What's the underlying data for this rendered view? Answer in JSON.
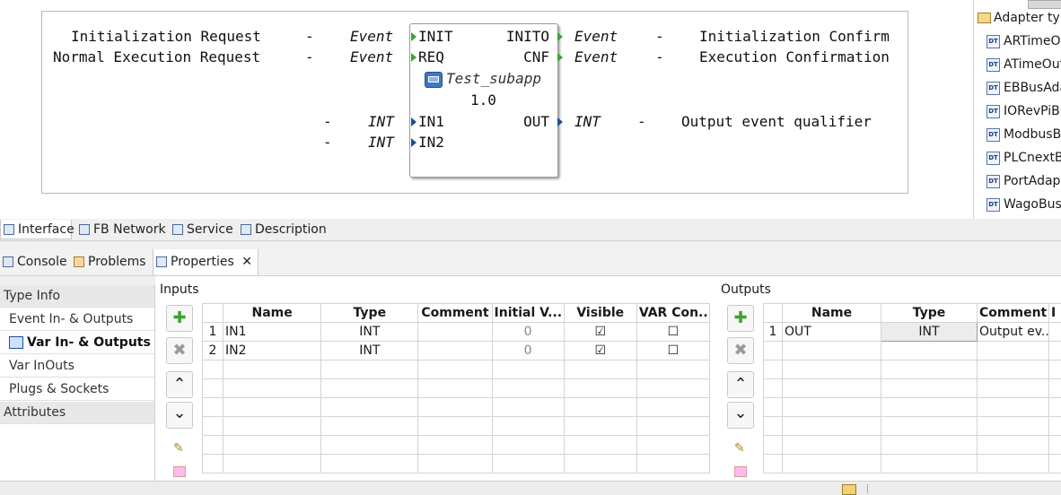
{
  "editor": {
    "left_rows": [
      {
        "desc": "Initialization Request",
        "dash": "-",
        "type": "Event"
      },
      {
        "desc": "Normal Execution Request",
        "dash": "-",
        "type": "Event"
      }
    ],
    "left_data_rows": [
      {
        "dash": "-",
        "type": "INT"
      },
      {
        "dash": "-",
        "type": "INT"
      }
    ],
    "right_rows": [
      {
        "type": "Event",
        "dash": "-",
        "desc": "Initialization Confirm"
      },
      {
        "type": "Event",
        "dash": "-",
        "desc": "Execution Confirmation"
      },
      {
        "type": "INT",
        "dash": "-",
        "desc": "Output event qualifier"
      }
    ],
    "fb": {
      "in_events": [
        "INIT",
        "REQ"
      ],
      "out_events": [
        "INITO",
        "CNF"
      ],
      "name": "Test_subapp",
      "version": "1.0",
      "in_vars": [
        "IN1",
        "IN2"
      ],
      "out_vars": [
        "OUT"
      ]
    }
  },
  "palette": {
    "header": "Adapter type",
    "items": [
      "ARTimeO",
      "ATimeOut",
      "EBBusAda",
      "IORevPiBu",
      "ModbusBu",
      "PLCnextB",
      "PortAdapt",
      "WagoBusA"
    ]
  },
  "editor_tabs": [
    "Interface",
    "FB Network",
    "Service",
    "Description"
  ],
  "view_tabs": [
    "Console",
    "Problems",
    "Properties"
  ],
  "nav": {
    "type_info": "Type Info",
    "items": [
      "Event In- & Outputs",
      "Var In- & Outputs",
      "Var InOuts",
      "Plugs & Sockets"
    ],
    "attributes": "Attributes"
  },
  "inputs": {
    "title": "Inputs",
    "columns": [
      "Name",
      "Type",
      "Comment",
      "Initial V...",
      "Visible",
      "VAR Con..."
    ],
    "rows": [
      {
        "num": "1",
        "name": "IN1",
        "type": "INT",
        "comment": "",
        "initial": "0",
        "visible": "☑",
        "varcon": "☐"
      },
      {
        "num": "2",
        "name": "IN2",
        "type": "INT",
        "comment": "",
        "initial": "0",
        "visible": "☑",
        "varcon": "☐"
      }
    ]
  },
  "outputs": {
    "title": "Outputs",
    "columns": [
      "Name",
      "Type",
      "Comment",
      "I"
    ],
    "rows": [
      {
        "num": "1",
        "name": "OUT",
        "type": "INT",
        "comment": "Output ev..."
      }
    ]
  }
}
